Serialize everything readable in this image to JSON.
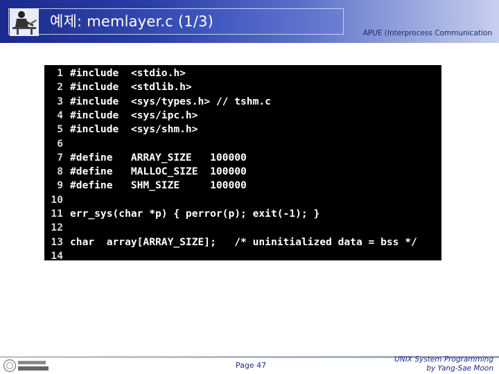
{
  "header": {
    "title": "예제: memlayer.c (1/3)",
    "subtitle": "APUE (Interprocess Communication"
  },
  "code": {
    "lines": [
      {
        "num": "1",
        "text": "#include  <stdio.h>"
      },
      {
        "num": "2",
        "text": "#include  <stdlib.h>"
      },
      {
        "num": "3",
        "text": "#include  <sys/types.h> // tshm.c"
      },
      {
        "num": "4",
        "text": "#include  <sys/ipc.h>"
      },
      {
        "num": "5",
        "text": "#include  <sys/shm.h>"
      },
      {
        "num": "6",
        "text": ""
      },
      {
        "num": "7",
        "text": "#define   ARRAY_SIZE   100000"
      },
      {
        "num": "8",
        "text": "#define   MALLOC_SIZE  100000"
      },
      {
        "num": "9",
        "text": "#define   SHM_SIZE     100000"
      },
      {
        "num": "10",
        "text": ""
      },
      {
        "num": "11",
        "text": "err_sys(char *p) { perror(p); exit(-1); }"
      },
      {
        "num": "12",
        "text": ""
      },
      {
        "num": "13",
        "text": "char  array[ARRAY_SIZE];   /* uninitialized data = bss */"
      },
      {
        "num": "14",
        "text": ""
      }
    ]
  },
  "footer": {
    "page": "Page 47",
    "course_line1": "UNIX System Programming",
    "course_line2": "by Yang-Sae Moon"
  },
  "icons": {
    "header_logo": "person-at-desk-icon",
    "footer_logo": "university-seal-icon"
  },
  "colors": {
    "header_blue": "#1c2a8e",
    "code_background": "#000000",
    "code_text": "#ffffff"
  }
}
